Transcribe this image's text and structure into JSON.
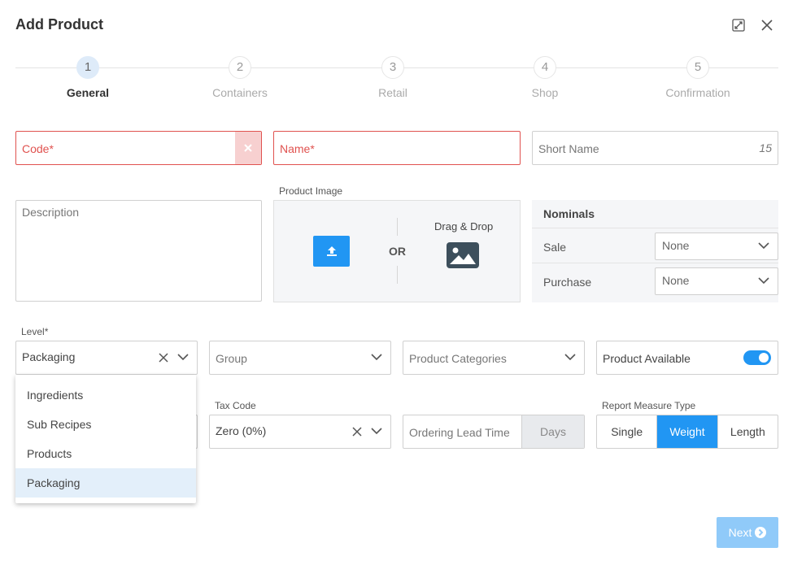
{
  "dialog": {
    "title": "Add Product"
  },
  "stepper": {
    "steps": [
      {
        "number": "1",
        "label": "General"
      },
      {
        "number": "2",
        "label": "Containers"
      },
      {
        "number": "3",
        "label": "Retail"
      },
      {
        "number": "4",
        "label": "Shop"
      },
      {
        "number": "5",
        "label": "Confirmation"
      }
    ],
    "active_step": 1
  },
  "form": {
    "code": {
      "placeholder": "Code*"
    },
    "name": {
      "placeholder": "Name*"
    },
    "short_name": {
      "placeholder": "Short Name",
      "counter": "15"
    },
    "description": {
      "placeholder": "Description"
    },
    "product_image": {
      "label": "Product Image",
      "or_text": "OR",
      "drag_drop_label": "Drag & Drop"
    },
    "nominals": {
      "title": "Nominals",
      "sale": {
        "label": "Sale",
        "value": "None"
      },
      "purchase": {
        "label": "Purchase",
        "value": "None"
      }
    },
    "level": {
      "label": "Level*",
      "value": "Packaging",
      "options": [
        "Ingredients",
        "Sub Recipes",
        "Products",
        "Packaging"
      ]
    },
    "group": {
      "placeholder": "Group"
    },
    "product_categories": {
      "placeholder": "Product Categories"
    },
    "product_available": {
      "label": "Product Available",
      "enabled": true
    },
    "tax_code": {
      "label": "Tax Code",
      "value": "Zero (0%)"
    },
    "ordering_lead_time": {
      "placeholder": "Ordering Lead Time",
      "unit": "Days"
    },
    "report_measure_type": {
      "label": "Report Measure Type",
      "options": [
        "Single",
        "Weight",
        "Length"
      ],
      "selected": "Weight"
    }
  },
  "footer": {
    "next_label": "Next"
  },
  "colors": {
    "accent": "#2196f3",
    "error": "#e0524f",
    "next_disabled": "#90caf9"
  }
}
